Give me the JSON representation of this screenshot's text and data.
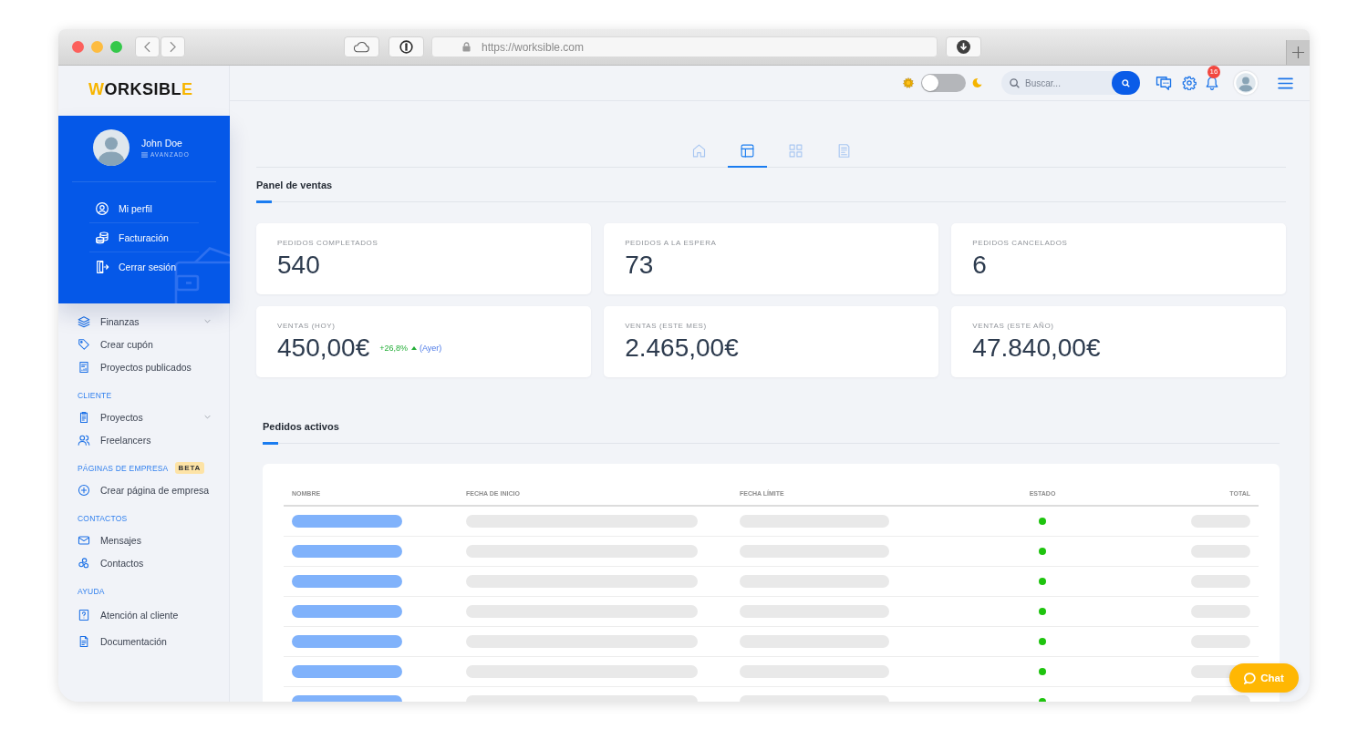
{
  "browser": {
    "url": "https://worksible.com"
  },
  "sidebar": {
    "logo": "WORKSIBLE",
    "sections": [
      {
        "items": [
          {
            "label": "Finanzas",
            "kind": "group"
          },
          {
            "label": "Crear cupón",
            "kind": "link"
          },
          {
            "label": "Proyectos publicados",
            "kind": "link"
          }
        ]
      },
      {
        "title": "CLIENTE",
        "items": [
          {
            "label": "Proyectos",
            "kind": "group"
          },
          {
            "label": "Freelancers",
            "kind": "link"
          }
        ]
      },
      {
        "title": "PÁGINAS DE EMPRESA",
        "badge": "BETA",
        "items": [
          {
            "label": "Crear página de empresa",
            "kind": "link"
          }
        ]
      },
      {
        "title": "CONTACTOS",
        "items": [
          {
            "label": "Mensajes",
            "kind": "link"
          },
          {
            "label": "Contactos",
            "kind": "link"
          }
        ]
      },
      {
        "title": "AYUDA",
        "items": [
          {
            "label": "Atención al cliente",
            "kind": "link"
          },
          {
            "label": "Documentación",
            "kind": "link"
          }
        ]
      }
    ]
  },
  "profile_menu": {
    "name": "John Doe",
    "role": "AVANZADO",
    "items": [
      {
        "label": "Mi perfil"
      },
      {
        "label": "Facturación"
      },
      {
        "label": "Cerrar sesión"
      }
    ]
  },
  "topbar": {
    "theme_toggle": {
      "on": false
    },
    "search": {
      "placeholder": "Buscar..."
    },
    "notification_count": "16"
  },
  "tabs": [
    {
      "selected": false
    },
    {
      "selected": true
    },
    {
      "selected": false
    },
    {
      "selected": false
    }
  ],
  "sales_panel": {
    "title": "Panel de ventas",
    "stats": [
      {
        "label": "PEDIDOS COMPLETADOS",
        "value": "540"
      },
      {
        "label": "PEDIDOS A LA ESPERA",
        "value": "73"
      },
      {
        "label": "PEDIDOS CANCELADOS",
        "value": "6"
      },
      {
        "label": "VENTAS (HOY)",
        "value": "450,00€",
        "change": "+26,8%",
        "comparison": "(Ayer)"
      },
      {
        "label": "VENTAS (ESTE MES)",
        "value": "2.465,00€"
      },
      {
        "label": "VENTAS (ESTE AÑO)",
        "value": "47.840,00€"
      }
    ]
  },
  "active_orders": {
    "title": "Pedidos activos",
    "columns": [
      "NOMBRE",
      "FECHA DE INICIO",
      "FECHA LÍMITE",
      "ESTADO",
      "TOTAL"
    ],
    "rows": [
      {
        "color": "#1fc40f"
      },
      {
        "color": "#1fc40f"
      },
      {
        "color": "#1fc40f"
      },
      {
        "color": "#1fc40f"
      },
      {
        "color": "#1fc40f"
      },
      {
        "color": "#1fc40f"
      },
      {
        "color": "#1fc40f"
      }
    ]
  },
  "chat_button": {
    "label": "Chat"
  }
}
